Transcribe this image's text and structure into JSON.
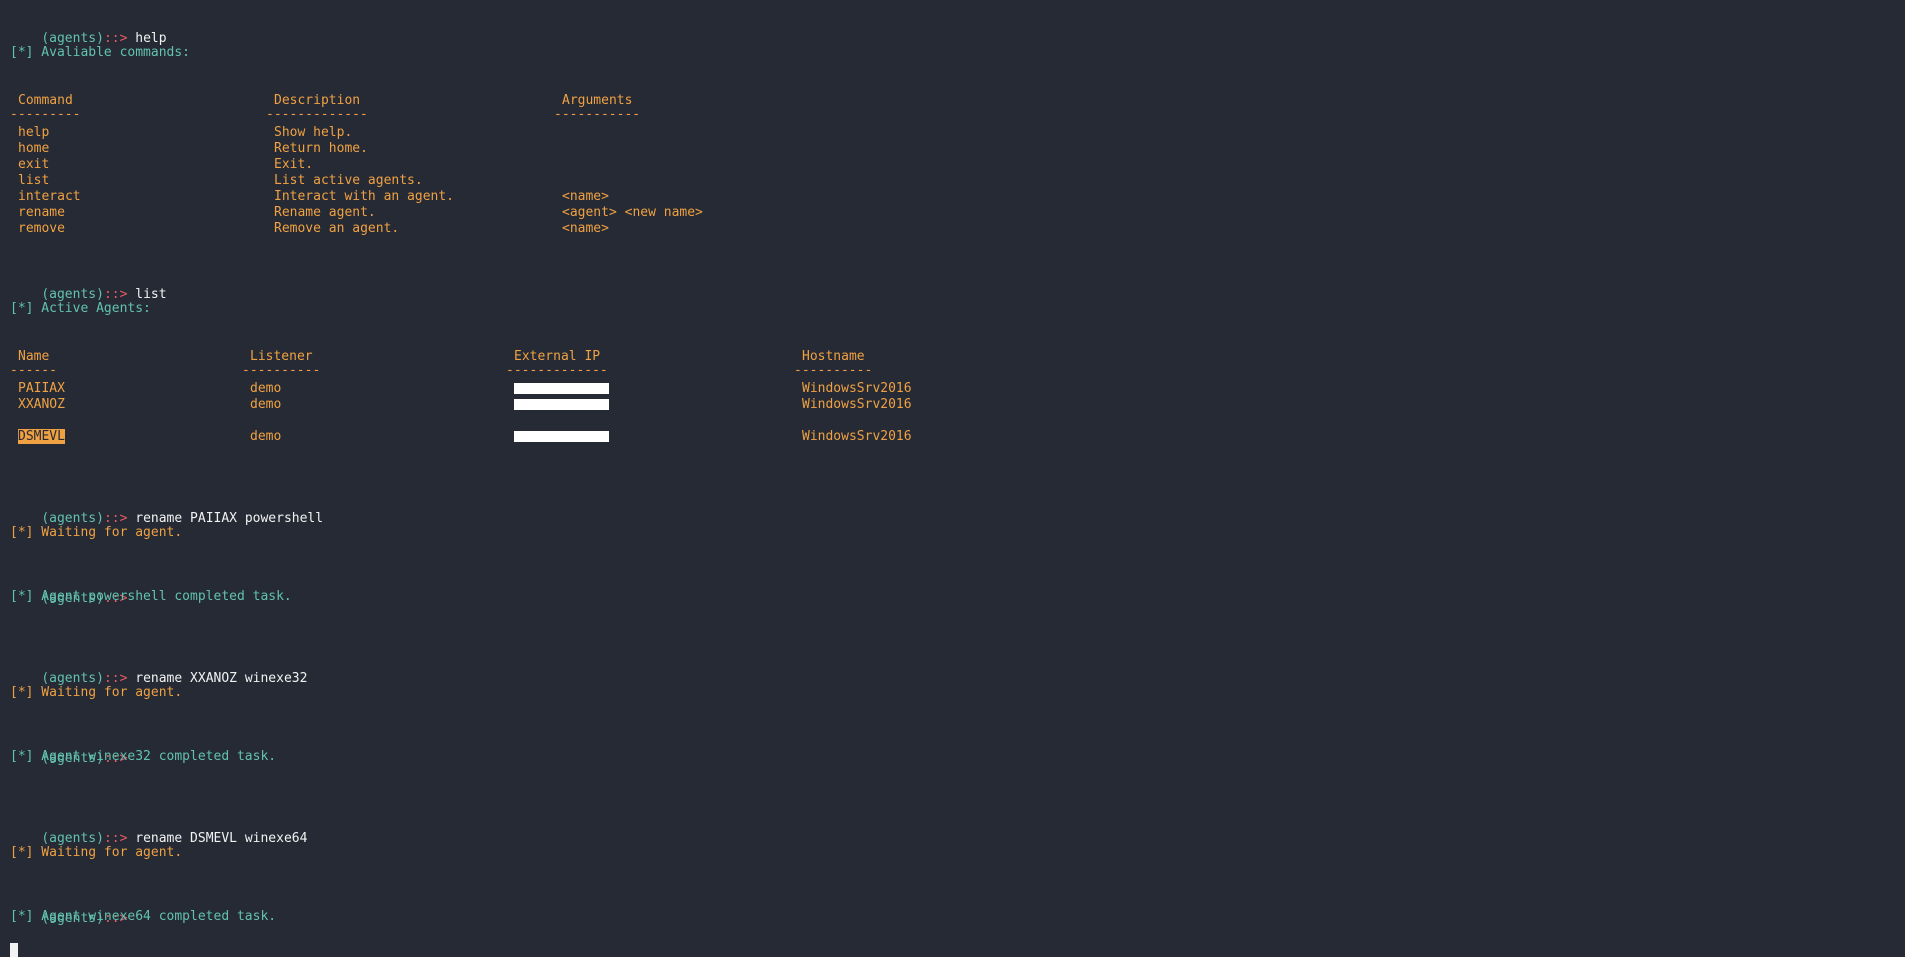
{
  "prompt": {
    "label": "(agents)",
    "arrow": "::>"
  },
  "commands": {
    "help": "help",
    "list": "list",
    "rename1": "rename PAIIAX powershell",
    "rename2": "rename XXANOZ winexe32",
    "rename3": "rename DSMEVL winexe64"
  },
  "help_section": {
    "title": "[*] Avaliable commands:",
    "headers": {
      "command": "Command",
      "description": "Description",
      "arguments": "Arguments"
    },
    "dashes": {
      "command": "---------",
      "description": "-------------",
      "arguments": "-----------"
    },
    "rows": [
      {
        "command": "help",
        "description": "Show help.",
        "arguments": ""
      },
      {
        "command": "home",
        "description": "Return home.",
        "arguments": ""
      },
      {
        "command": "exit",
        "description": "Exit.",
        "arguments": ""
      },
      {
        "command": "list",
        "description": "List active agents.",
        "arguments": ""
      },
      {
        "command": "interact",
        "description": "Interact with an agent.",
        "arguments": "<name>"
      },
      {
        "command": "rename",
        "description": "Rename agent.",
        "arguments": "<agent> <new name>"
      },
      {
        "command": "remove",
        "description": "Remove an agent.",
        "arguments": "<name>"
      }
    ]
  },
  "agents_section": {
    "title": "[*] Active Agents:",
    "headers": {
      "name": "Name",
      "listener": "Listener",
      "external_ip": "External IP",
      "hostname": "Hostname"
    },
    "dashes": {
      "name": "------",
      "listener": "----------",
      "external_ip": "-------------",
      "hostname": "----------"
    },
    "rows": [
      {
        "name": "PAIIAX",
        "listener": "demo",
        "hostname": "WindowsSrv2016"
      },
      {
        "name": "XXANOZ",
        "listener": "demo",
        "hostname": "WindowsSrv2016"
      },
      {
        "name": "DSMEVL",
        "listener": "demo",
        "hostname": "WindowsSrv2016"
      }
    ]
  },
  "messages": {
    "waiting": "[*] Waiting for agent.",
    "completed1": "[*] Agent powershell completed task.",
    "completed2": "[*] Agent winexe32 completed task.",
    "completed3": "[*] Agent winexe64 completed task."
  },
  "colors": {
    "background": "#252a35",
    "teal": "#62c2ad",
    "orange": "#f0a142",
    "red": "#e85a64",
    "white": "#f2f2f2"
  }
}
